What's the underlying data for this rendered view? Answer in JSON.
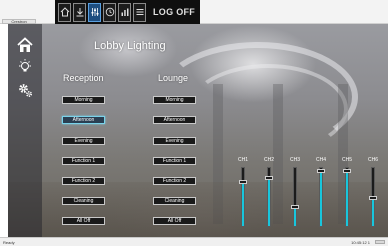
{
  "window": {
    "app_badge": "Crestron"
  },
  "toolbar": {
    "buttons": [
      {
        "icon": "home-icon"
      },
      {
        "icon": "download-icon"
      },
      {
        "icon": "sliders-icon",
        "active": true
      },
      {
        "icon": "clock-icon"
      },
      {
        "icon": "bar-chart-icon"
      },
      {
        "icon": "list-icon"
      }
    ],
    "logoff_label": "LOG OFF"
  },
  "sidebar": {
    "items": [
      {
        "icon": "home-icon"
      },
      {
        "icon": "lightbulb-icon"
      },
      {
        "icon": "settings-gears-icon"
      }
    ]
  },
  "page": {
    "title": "Lobby Lighting"
  },
  "reception": {
    "title": "Reception",
    "scenes": [
      "Morning",
      "Afternoon",
      "Evening",
      "Function 1",
      "Function 2",
      "Cleaning",
      "All Off"
    ],
    "selected": "Afternoon"
  },
  "lounge": {
    "title": "Lounge",
    "scenes": [
      "Morning",
      "Afternoon",
      "Evening",
      "Function 1",
      "Function 2",
      "Cleaning",
      "All Off"
    ]
  },
  "channels": [
    {
      "label": "CH1",
      "level": 0.75
    },
    {
      "label": "CH2",
      "level": 0.83
    },
    {
      "label": "CH3",
      "level": 0.33
    },
    {
      "label": "CH4",
      "level": 0.95
    },
    {
      "label": "CH5",
      "level": 0.95
    },
    {
      "label": "CH6",
      "level": 0.48
    }
  ],
  "colors": {
    "accent": "#18c6dc",
    "toolbar_bg": "#0f0f0f",
    "button_bg": "#1a1a1a"
  },
  "status": {
    "left": "Ready",
    "right": "10:45:12 1"
  }
}
